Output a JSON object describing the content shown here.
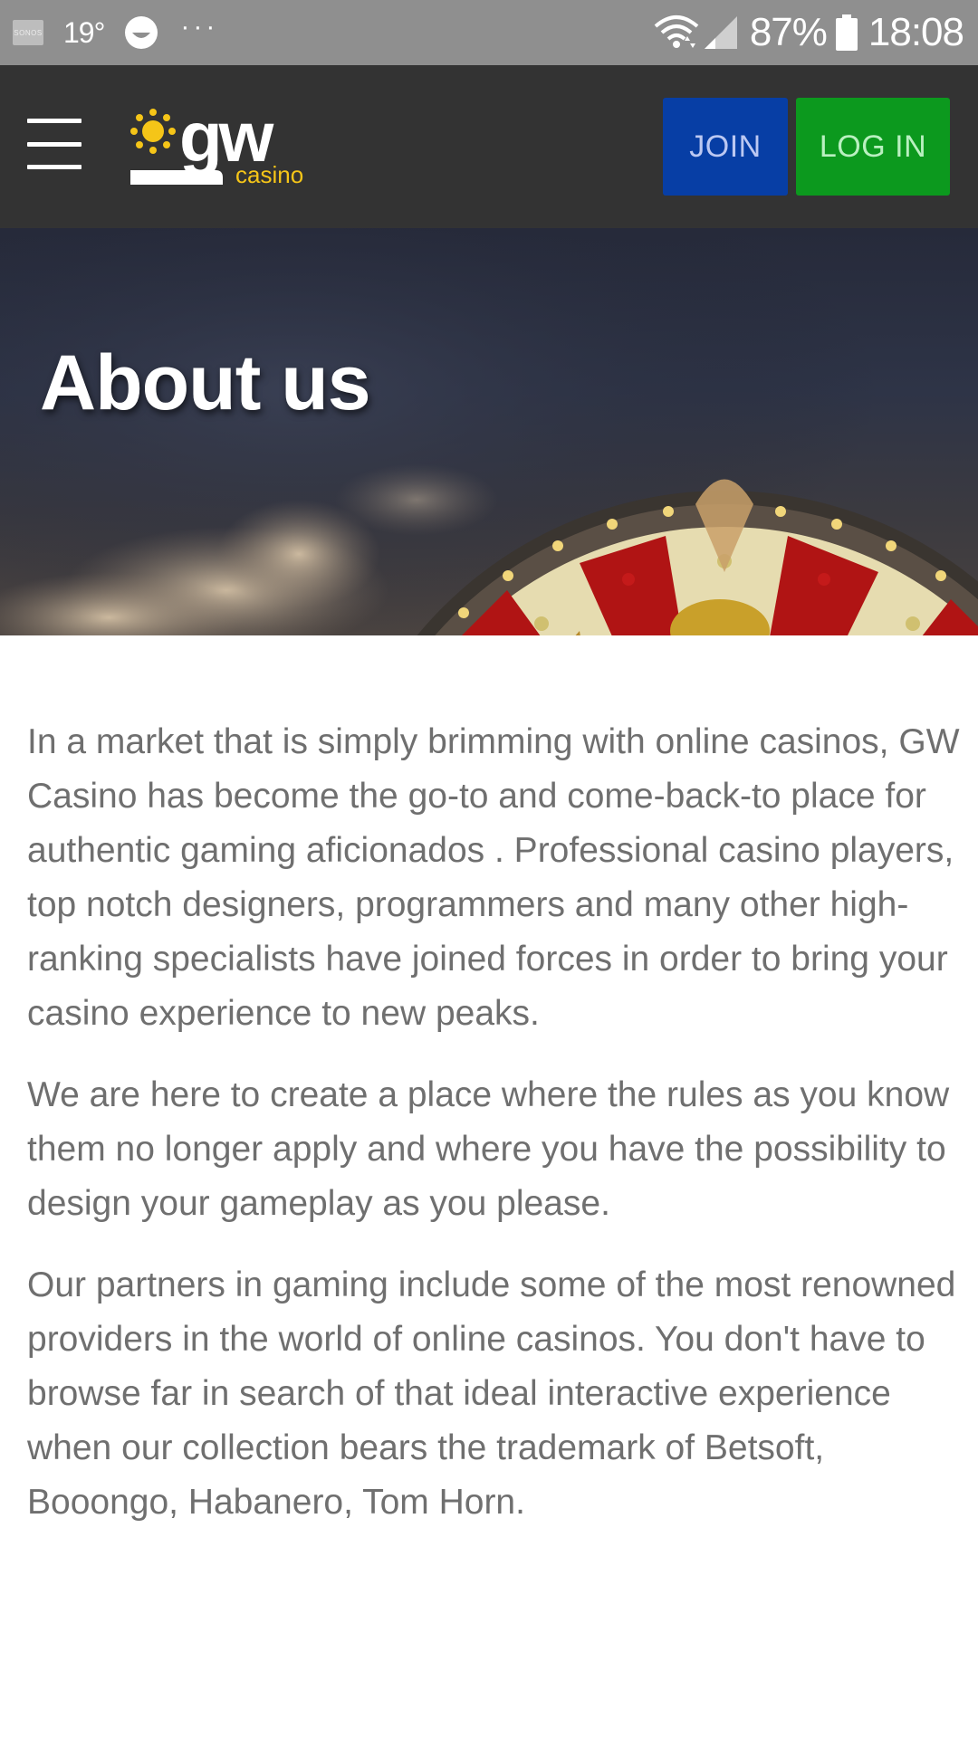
{
  "status_bar": {
    "sonos_label": "SONOS",
    "temperature": "19°",
    "more_dots": "···",
    "battery_percent": "87%",
    "time": "18:08"
  },
  "header": {
    "logo_main": "gw",
    "logo_sub": "casino",
    "join_label": "JOIN",
    "login_label": "LOG IN"
  },
  "hero": {
    "title": "About us"
  },
  "content": {
    "paragraphs": [
      "In a market that is simply brimming with online casinos, GW Casino has become the go-to and come-back-to place for authentic gaming aficionados . Professional casino players, top notch designers, programmers and many other high-ranking specialists have joined forces in order to bring your casino experience to new peaks.",
      "We are here to create a place where the rules as you know them no longer apply and where you have the possibility to design your gameplay as you please.",
      "Our partners in gaming include some of the most renowned providers in the world of online casinos. You don't have to browse far in search of that ideal interactive experience when our collection bears the trademark of Betsoft, Booongo, Habanero, Tom Horn."
    ]
  },
  "colors": {
    "status_bar_bg": "#8f8f8f",
    "header_bg": "#333333",
    "join_bg": "#073ea5",
    "login_bg": "#0c991e",
    "logo_accent": "#f5c518",
    "body_text": "#6f6f6f"
  },
  "icons": {
    "menu": "hamburger-menu-icon",
    "status": [
      "smiley-icon",
      "wifi-icon",
      "signal-icon",
      "battery-icon"
    ]
  }
}
